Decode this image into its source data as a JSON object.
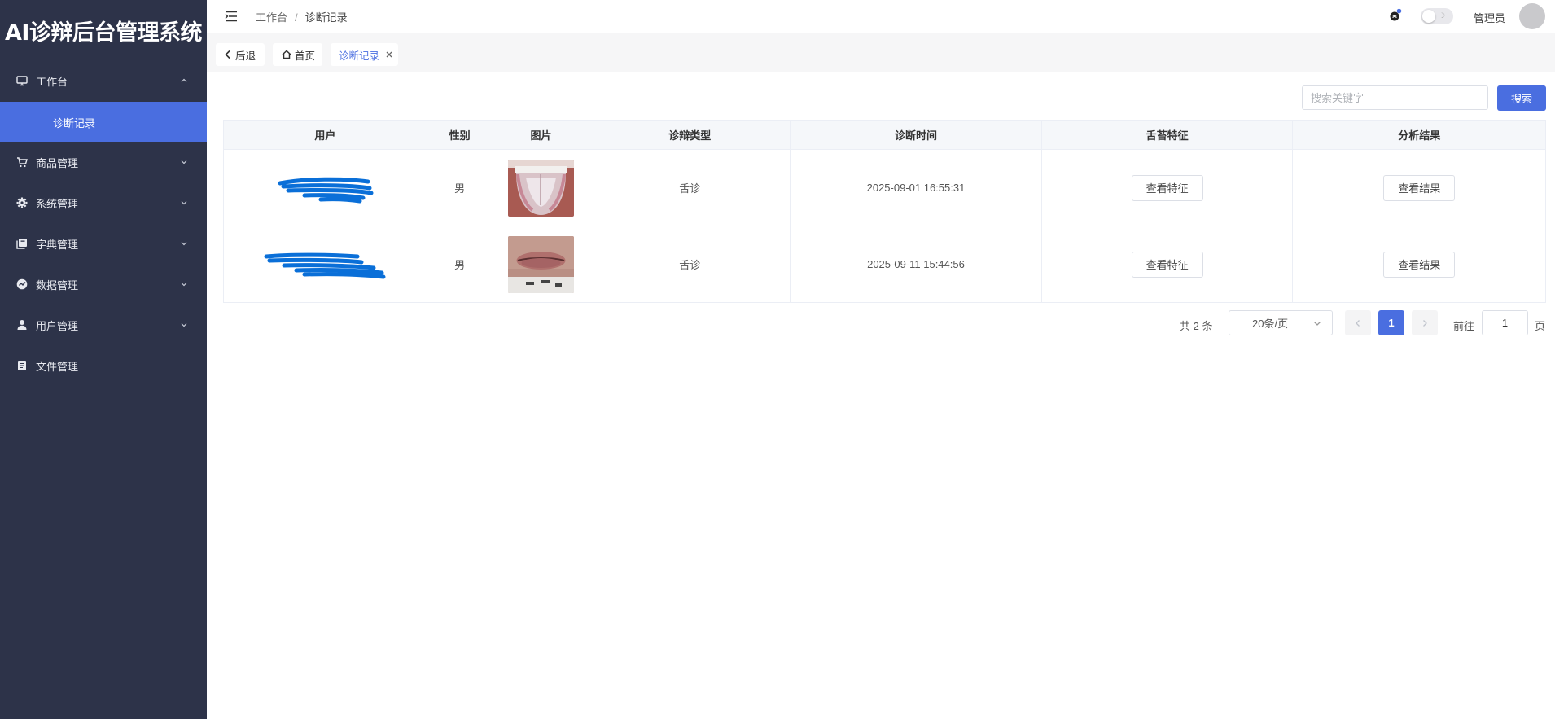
{
  "app": {
    "title": "AI诊辩后台管理系统"
  },
  "sidebar": {
    "items": [
      {
        "label": "工作台",
        "icon": "monitor-icon",
        "expanded": true
      },
      {
        "label": "诊断记录",
        "active": true
      },
      {
        "label": "商品管理",
        "icon": "cart-icon"
      },
      {
        "label": "系统管理",
        "icon": "gear-icon"
      },
      {
        "label": "字典管理",
        "icon": "dictionary-icon"
      },
      {
        "label": "数据管理",
        "icon": "chart-icon"
      },
      {
        "label": "用户管理",
        "icon": "user-icon"
      },
      {
        "label": "文件管理",
        "icon": "file-icon"
      }
    ]
  },
  "header": {
    "breadcrumb": [
      "工作台",
      "诊断记录"
    ],
    "breadcrumb_sep": "/",
    "user": "管理员",
    "theme_toggle_glyph": "☽"
  },
  "tabs": {
    "back": "后退",
    "home": "首页",
    "current": "诊断记录"
  },
  "search": {
    "placeholder": "搜索关键字",
    "button": "搜索"
  },
  "table": {
    "columns": [
      "用户",
      "性别",
      "图片",
      "诊辩类型",
      "诊断时间",
      "舌苔特征",
      "分析结果"
    ],
    "rows": [
      {
        "gender": "男",
        "type": "舌诊",
        "time": "2025-09-01 16:55:31",
        "feature_btn": "查看特征",
        "result_btn": "查看结果"
      },
      {
        "gender": "男",
        "type": "舌诊",
        "time": "2025-09-11 15:44:56",
        "feature_btn": "查看特征",
        "result_btn": "查看结果"
      }
    ]
  },
  "pagination": {
    "total": "共 2 条",
    "page_size": "20条/页",
    "current": "1",
    "goto_label": "前往",
    "goto_value": "1",
    "unit": "页"
  },
  "colors": {
    "sidebar": "#2d3349",
    "accent": "#4a6ee0",
    "redaction": "#0a6fd8"
  }
}
